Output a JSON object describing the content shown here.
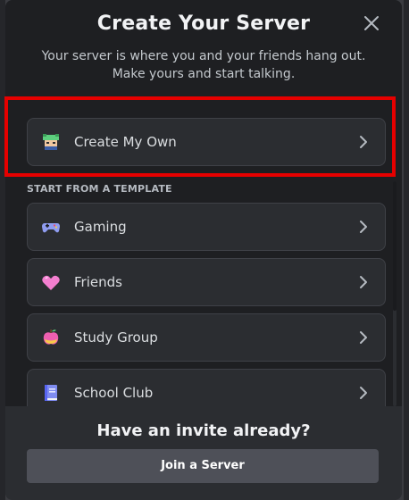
{
  "modal": {
    "title": "Create Your Server",
    "subtitle": "Your server is where you and your friends hang out. Make yours and start talking.",
    "close_icon": "close-icon"
  },
  "create_own": {
    "label": "Create My Own",
    "icon": "create-own-icon"
  },
  "templates": {
    "section_label": "START FROM A TEMPLATE",
    "items": [
      {
        "label": "Gaming",
        "icon": "gamepad-icon"
      },
      {
        "label": "Friends",
        "icon": "heart-icon"
      },
      {
        "label": "Study Group",
        "icon": "apple-icon"
      },
      {
        "label": "School Club",
        "icon": "book-icon"
      }
    ]
  },
  "footer": {
    "title": "Have an invite already?",
    "join_label": "Join a Server"
  },
  "colors": {
    "highlight": "#e60000",
    "accent": "#5865f2"
  }
}
